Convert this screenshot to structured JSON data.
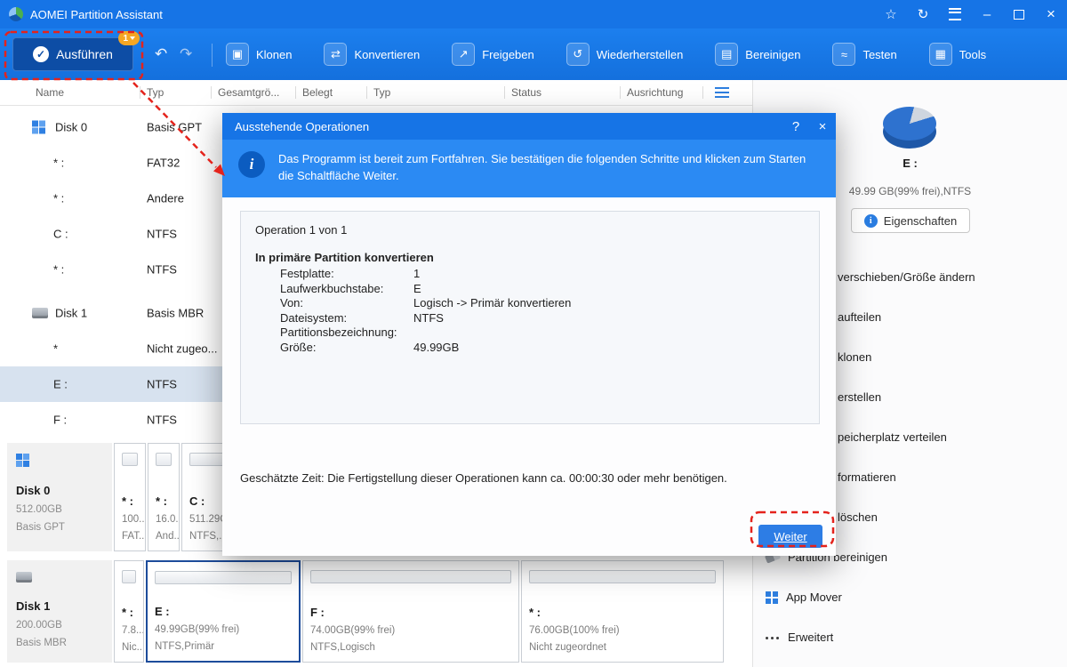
{
  "titlebar": {
    "app_title": "AOMEI Partition Assistant",
    "star_icon": "☆",
    "refresh_icon": "↻",
    "minimize_icon": "–",
    "close_icon": "×"
  },
  "toolbar": {
    "apply": {
      "label": "Ausführen",
      "badge": "1",
      "check_icon": "✓"
    },
    "undo_icon": "↶",
    "redo_icon": "↷",
    "items": [
      {
        "label": "Klonen",
        "icon": "clone-icon",
        "glyph": "▣"
      },
      {
        "label": "Konvertieren",
        "icon": "convert-icon",
        "glyph": "⇄"
      },
      {
        "label": "Freigeben",
        "icon": "share-icon",
        "glyph": "↗"
      },
      {
        "label": "Wiederherstellen",
        "icon": "restore-icon",
        "glyph": "↺"
      },
      {
        "label": "Bereinigen",
        "icon": "clean-icon",
        "glyph": "▤"
      },
      {
        "label": "Testen",
        "icon": "test-icon",
        "glyph": "≈"
      },
      {
        "label": "Tools",
        "icon": "tools-icon",
        "glyph": "▦"
      }
    ]
  },
  "table": {
    "columns": [
      "Name",
      "Typ",
      "Gesamtgrö...",
      "Belegt",
      "Typ",
      "Status",
      "Ausrichtung"
    ],
    "rows": [
      {
        "name": "Disk 0",
        "typ": "Basis GPT"
      },
      {
        "name": "* :",
        "typ": "FAT32"
      },
      {
        "name": "* :",
        "typ": "Andere"
      },
      {
        "name": "C :",
        "typ": "NTFS"
      },
      {
        "name": "* :",
        "typ": "NTFS"
      },
      {
        "name": "Disk 1",
        "typ": "Basis MBR"
      },
      {
        "name": "*",
        "typ": "Nicht zugeo..."
      },
      {
        "name": "E :",
        "typ": "NTFS"
      },
      {
        "name": "F :",
        "typ": "NTFS"
      }
    ]
  },
  "disks": [
    {
      "name": "Disk 0",
      "size": "512.00GB",
      "style": "Basis GPT",
      "partitions": [
        {
          "name": "* :",
          "size": "100...",
          "fs": "FAT..."
        },
        {
          "name": "* :",
          "size": "16.0...",
          "fs": "And..."
        },
        {
          "name": "C :",
          "size": "511.29G...",
          "fs": "NTFS,..."
        }
      ]
    },
    {
      "name": "Disk 1",
      "size": "200.00GB",
      "style": "Basis MBR",
      "partitions": [
        {
          "name": "* :",
          "size": "7.8...",
          "fs": "Nic..."
        },
        {
          "name": "E :",
          "size": "49.99GB(99% frei)",
          "fs": "NTFS,Primär"
        },
        {
          "name": "F :",
          "size": "74.00GB(99% frei)",
          "fs": "NTFS,Logisch"
        },
        {
          "name": "* :",
          "size": "76.00GB(100% frei)",
          "fs": "Nicht zugeordnet"
        }
      ]
    }
  ],
  "side_panel": {
    "volume_label": "E :",
    "volume_info": "49.99 GB(99% frei),NTFS",
    "properties_label": "Eigenschaften",
    "properties_icon": "i",
    "menu": [
      {
        "label": "verschieben/Größe ändern"
      },
      {
        "label": "aufteilen"
      },
      {
        "label": "klonen"
      },
      {
        "label": "erstellen"
      },
      {
        "label": "peicherplatz verteilen"
      },
      {
        "label": "formatieren"
      },
      {
        "label": "löschen"
      },
      {
        "label": "Partition bereinigen"
      },
      {
        "label": "App Mover"
      },
      {
        "label": "Erweitert"
      }
    ]
  },
  "dialog": {
    "title": "Ausstehende Operationen",
    "help_icon": "?",
    "close_icon": "×",
    "info_icon": "i",
    "banner_text": "Das Programm ist bereit zum Fortfahren. Sie bestätigen die folgenden Schritte und klicken zum Starten die Schaltfläche Weiter.",
    "operation_count": "Operation 1 von 1",
    "operation_title": "In primäre Partition konvertieren",
    "fields": [
      {
        "key": "Festplatte:",
        "value": "1"
      },
      {
        "key": "Laufwerkbuchstabe:",
        "value": "E"
      },
      {
        "key": "Von:",
        "value": "Logisch -> Primär konvertieren"
      },
      {
        "key": "Dateisystem:",
        "value": "NTFS"
      },
      {
        "key": "Partitionsbezeichnung:",
        "value": ""
      },
      {
        "key": "Größe:",
        "value": "49.99GB"
      }
    ],
    "estimate_text": "Geschätzte Zeit: Die Fertigstellung dieser Operationen kann ca. 00:00:30 oder mehr benötigen.",
    "next_label": "Weiter"
  },
  "annotation_color": "#e4231c"
}
